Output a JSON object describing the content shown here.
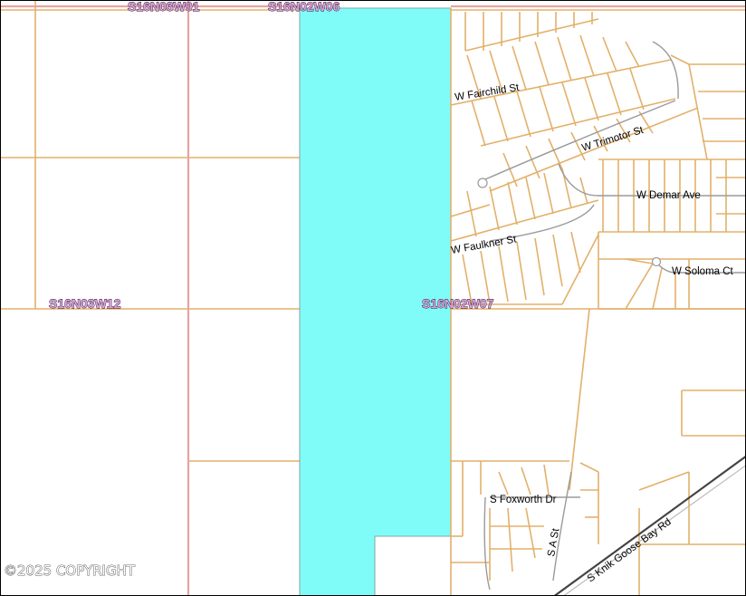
{
  "map": {
    "highlight_color": "#80fcf8",
    "parcel_line_color": "#e3b06a",
    "section_line_color": "#e9a2a2",
    "section_labels": [
      "S16N03W01",
      "S16N02W06",
      "S16N03W12",
      "S16N02W07"
    ],
    "streets": [
      "W Fairchild St",
      "W Trimotor St",
      "W Demar Ave",
      "W Faulkner St",
      "W Soloma Ct",
      "S Foxworth Dr",
      "S A St",
      "S Knik Goose Bay Rd"
    ],
    "copyright": "©2025 COPYRIGHT"
  }
}
